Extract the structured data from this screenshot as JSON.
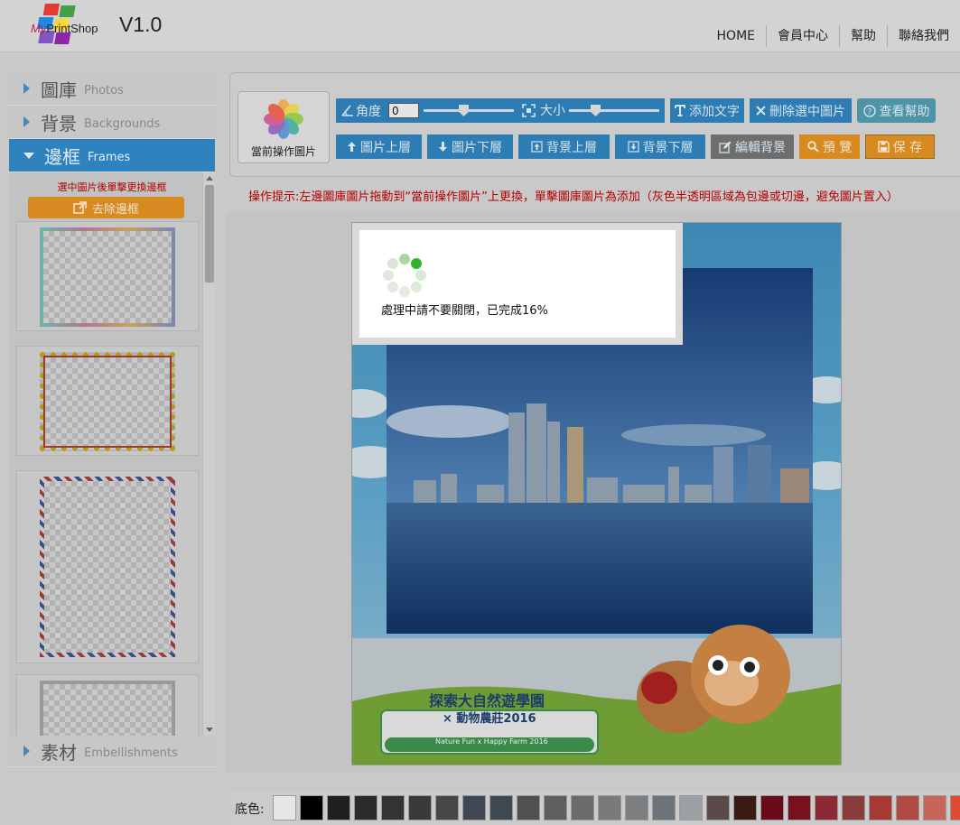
{
  "header": {
    "logo_text_prefix": "My",
    "logo_text_suffix": "PrintShop",
    "version": "V1.0",
    "nav": [
      "HOME",
      "會員中心",
      "幫助",
      "聯絡我們"
    ]
  },
  "sidebar": {
    "sections": [
      {
        "cn": "圖庫",
        "en": "Photos"
      },
      {
        "cn": "背景",
        "en": "Backgrounds"
      },
      {
        "cn": "邊框",
        "en": "Frames"
      },
      {
        "cn": "素材",
        "en": "Embellishments"
      }
    ],
    "frames_tip": "選中圖片後單擊更換邊框",
    "remove_frame_label": "去除邊框"
  },
  "toolbar": {
    "current_image_label": "當前操作圖片",
    "angle_label": "角度",
    "angle_value": "0",
    "size_label": "大小",
    "add_text": "添加文字",
    "delete_selected": "刪除選中圖片",
    "view_help": "查看幫助",
    "image_up": "圖片上層",
    "image_down": "圖片下層",
    "bg_up": "背景上層",
    "bg_down": "背景下層",
    "edit_bg": "編輯背景",
    "preview": "預 覽",
    "save": "保 存"
  },
  "hint": "操作提示:左邊圖庫圖片拖動到“當前操作圖片”上更換，單擊圖庫圖片為添加（灰色半透明區域為包邊或切邊，避免圖片置入）",
  "loading": {
    "text": "處理中請不要關閉，已完成16%",
    "progress": 0.16
  },
  "canvas": {
    "banner_title": "探索大自然遊學園",
    "banner_sub": "× 動物農莊2016",
    "banner_en": "Nature Fun x Happy Farm 2016"
  },
  "swatches": {
    "label": "底色:",
    "colors": [
      "#e6e6e6",
      "#000000",
      "#1f1f1f",
      "#2b2b2b",
      "#333333",
      "#3a3a3a",
      "#474747",
      "#3f4854",
      "#3d4a52",
      "#505050",
      "#5e5e5e",
      "#6b6b6b",
      "#7a7a7a",
      "#7b7f82",
      "#6b737b",
      "#9ba0a4",
      "#5a4a4a",
      "#3a1a12",
      "#6a0a1a",
      "#78101f",
      "#8c2a33",
      "#8a3c3c",
      "#a63a32",
      "#b04a42",
      "#c8645a",
      "#e04a32"
    ]
  },
  "icons": {
    "angle": "angle-icon",
    "size": "resize-icon",
    "text": "text-icon",
    "delete": "close-icon",
    "help": "help-icon",
    "up": "arrow-up-icon",
    "down": "arrow-down-icon",
    "edit": "edit-icon",
    "search": "search-icon",
    "save": "save-icon"
  }
}
